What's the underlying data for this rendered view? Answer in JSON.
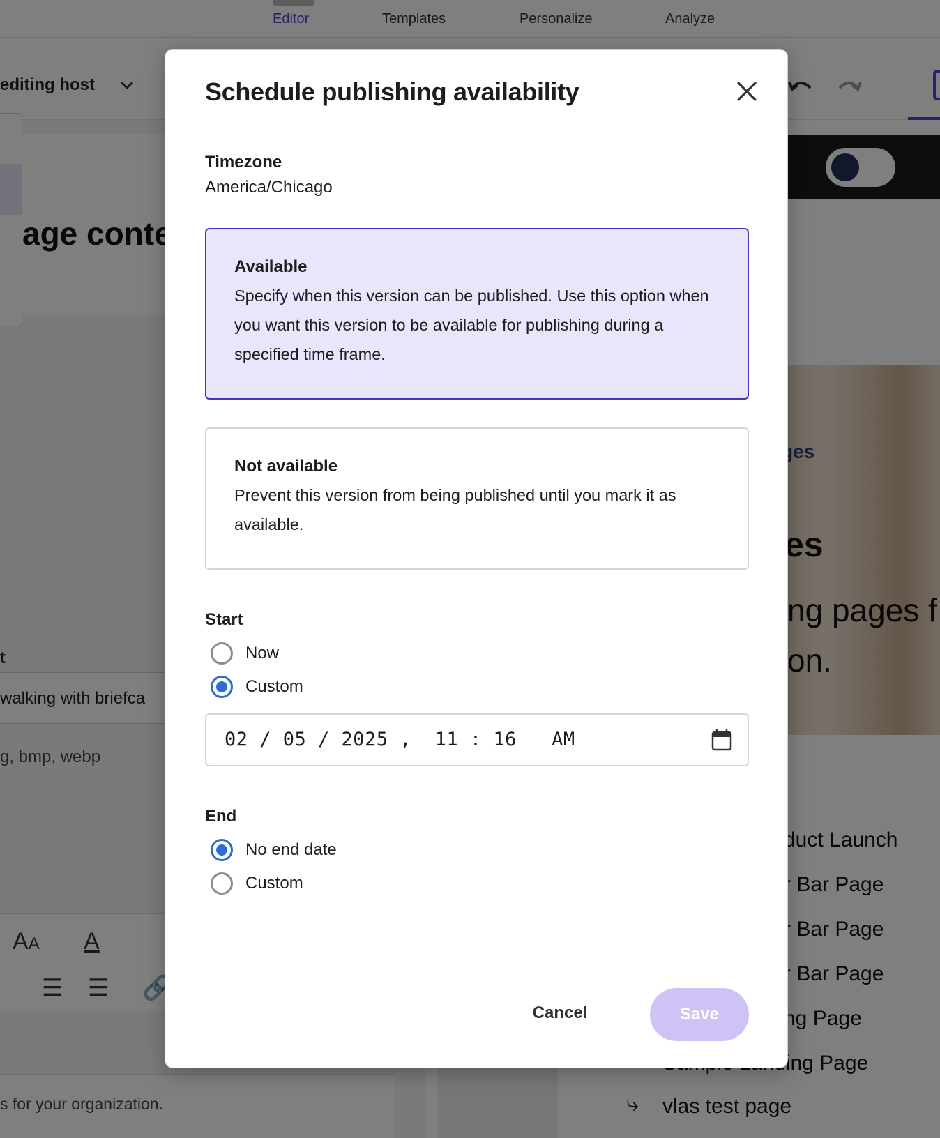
{
  "topnav": {
    "tabs": [
      {
        "label": "Editor",
        "active": true
      },
      {
        "label": "Templates",
        "active": false
      },
      {
        "label": "Personalize",
        "active": false
      },
      {
        "label": "Analyze",
        "active": false
      }
    ]
  },
  "toolbar": {
    "host_label": "editing host"
  },
  "left_panel": {
    "heading": "age conte",
    "field_label": "t",
    "field_value": "walking with briefca",
    "file_hint": "g, bmp, webp",
    "footer_text": "s for your organization."
  },
  "preview": {
    "hero_eyebrow": "ges",
    "hero_title": "es",
    "hero_sub_line1": "ting pages f",
    "hero_sub_line2": "tion.",
    "page_items": [
      "duct Launch",
      "r Bar Page",
      "r Bar Page",
      "r Bar Page",
      "ng Page",
      "Sample Landing Page"
    ],
    "last_item": "vlas test page"
  },
  "modal": {
    "title": "Schedule publishing availability",
    "timezone_label": "Timezone",
    "timezone_value": "America/Chicago",
    "options": {
      "available": {
        "title": "Available",
        "description": "Specify when this version can be published. Use this option when you want this version to be available for publishing during a specified time frame.",
        "selected": true
      },
      "not_available": {
        "title": "Not available",
        "description": "Prevent this version from being published until you mark it as available.",
        "selected": false
      }
    },
    "start": {
      "label": "Start",
      "options": [
        "Now",
        "Custom"
      ],
      "selected": "Custom",
      "datetime": "02 / 05 / 2025 ,  11 : 16   AM"
    },
    "end": {
      "label": "End",
      "options": [
        "No end date",
        "Custom"
      ],
      "selected": "No end date"
    },
    "cancel_label": "Cancel",
    "save_label": "Save"
  },
  "colors": {
    "accent": "#4c33c2",
    "radio_checked": "#2b6cdb",
    "selected_card_bg": "#e9e6fb",
    "save_disabled_bg": "#cfc3f5"
  }
}
